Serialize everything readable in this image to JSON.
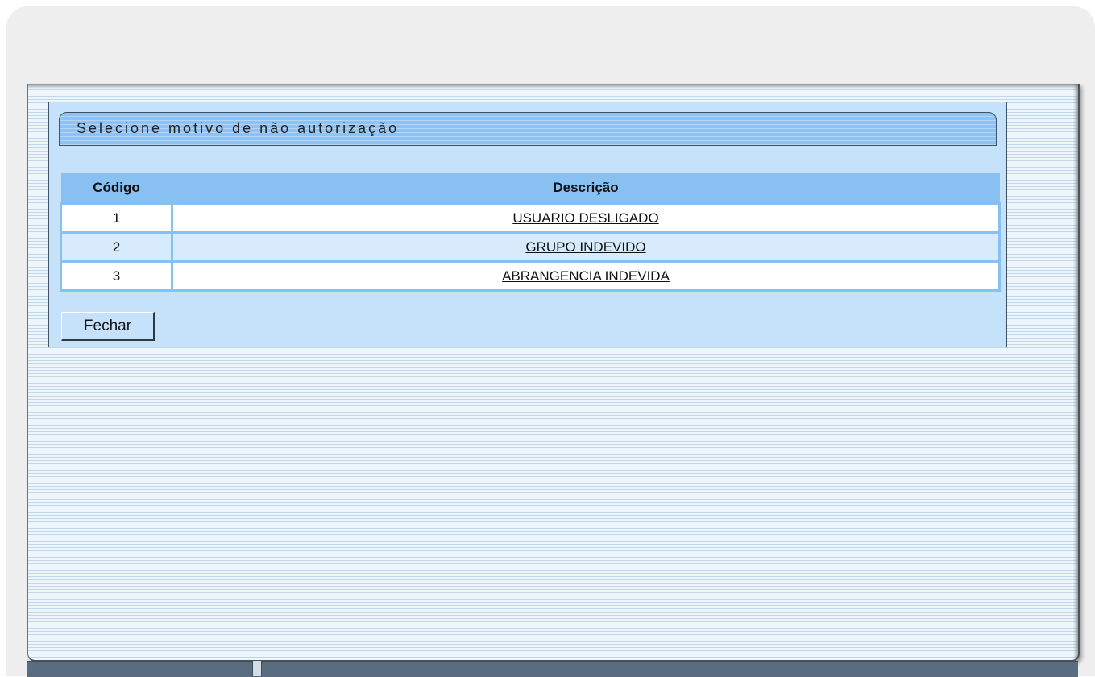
{
  "dialog": {
    "title": "Selecione motivo de não autorização",
    "table": {
      "headers": {
        "code": "Código",
        "description": "Descrição"
      },
      "rows": [
        {
          "code": "1",
          "description": "USUARIO DESLIGADO"
        },
        {
          "code": "2",
          "description": "GRUPO INDEVIDO"
        },
        {
          "code": "3",
          "description": "ABRANGENCIA INDEVIDA"
        }
      ]
    },
    "close_label": "Fechar"
  },
  "colors": {
    "panel_background": "#c6e2fb",
    "header_band": "#8fc2f3",
    "table_header": "#89c0f2",
    "row_alt": "#d7ebfd",
    "frame": "#eeeeee"
  }
}
